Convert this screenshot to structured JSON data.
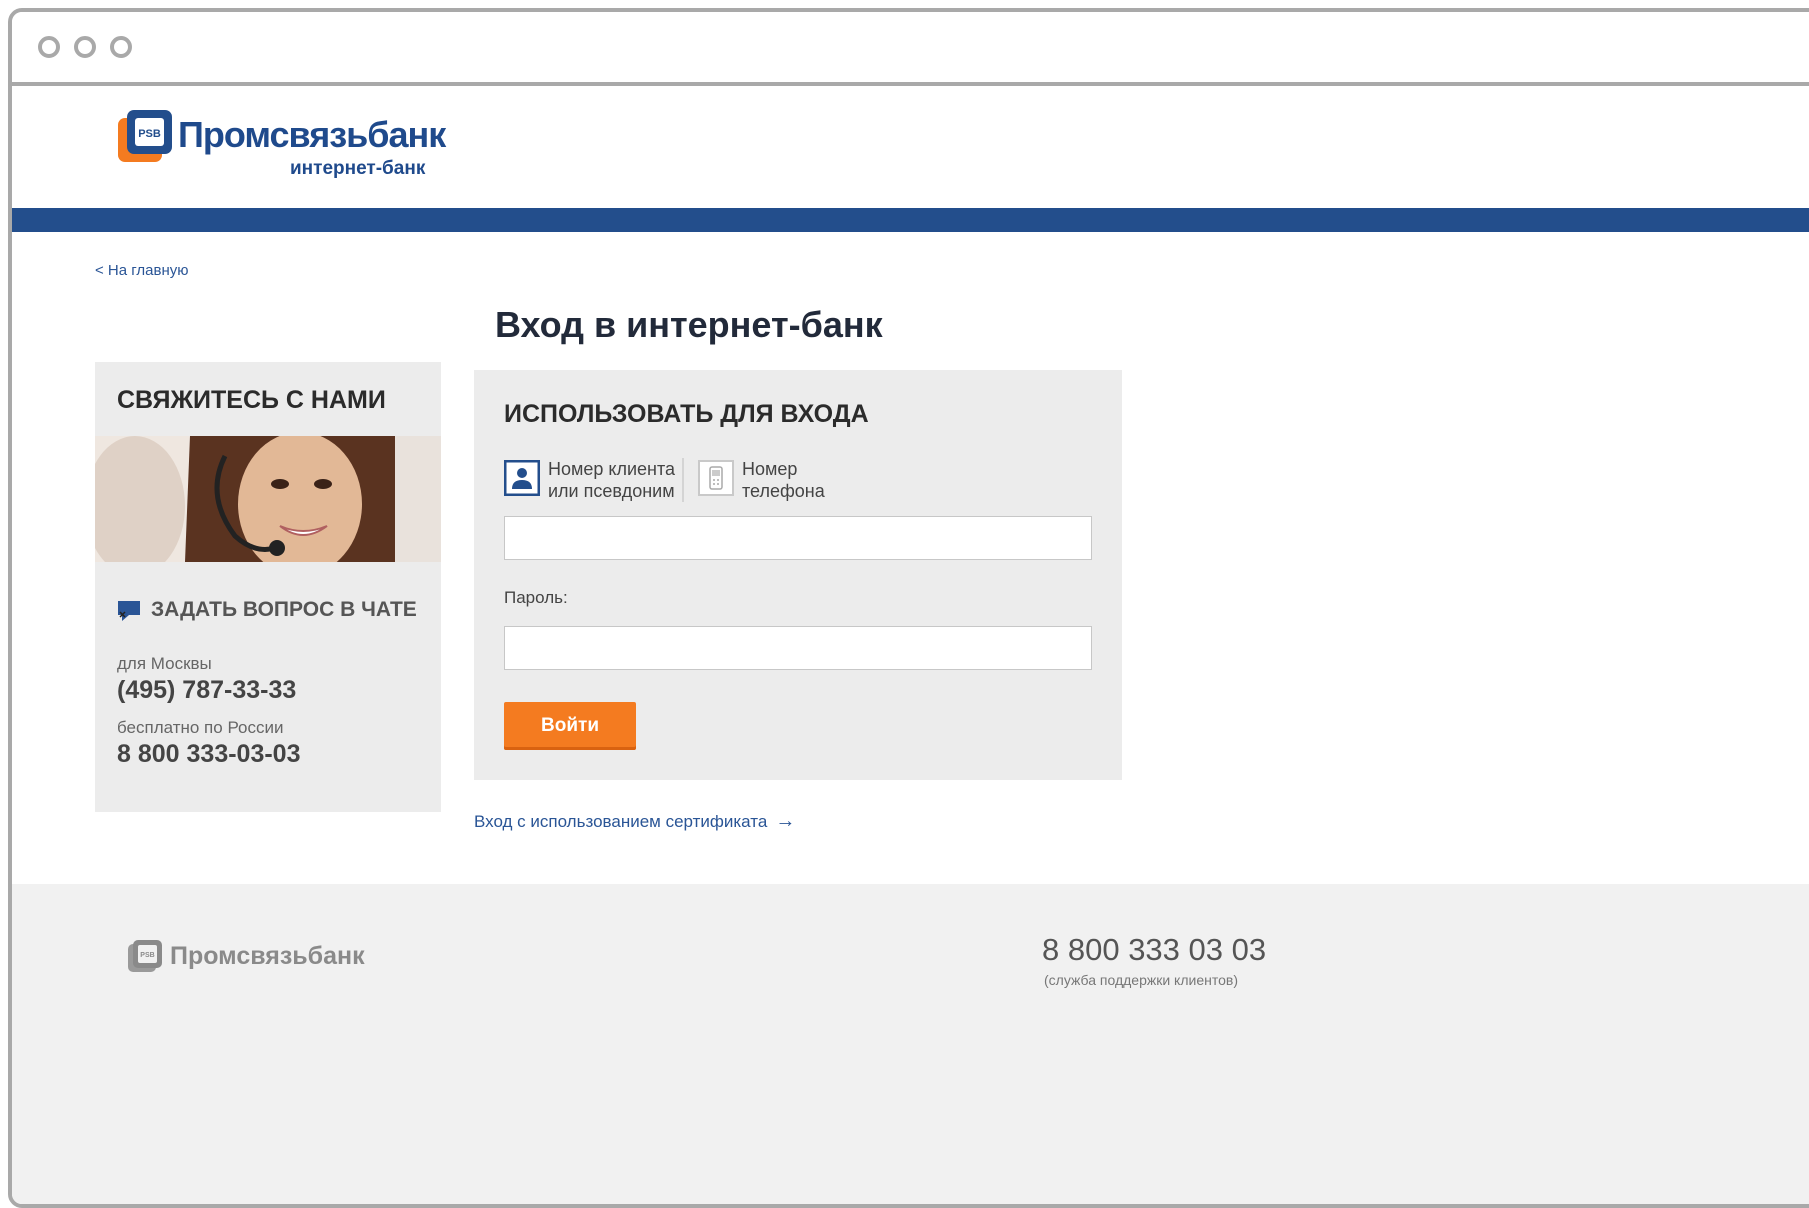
{
  "window": {
    "controls": [
      "window-dot",
      "window-dot",
      "window-dot"
    ]
  },
  "header": {
    "logo_text": "Промсвязьбанк",
    "logo_subtitle": "интернет-банк",
    "logo_mark_text": "PSB",
    "accent_color": "#234e8c",
    "logo_orange": "#f47b20"
  },
  "nav": {
    "back_link": "< На главную"
  },
  "page": {
    "title": "Вход в интернет-банк"
  },
  "contact": {
    "title": "СВЯЖИТЕСЬ С НАМИ",
    "chat_label": "ЗАДАТЬ ВОПРОС В ЧАТЕ",
    "city_label": "для Москвы",
    "city_phone": "(495) 787-33-33",
    "free_label": "бесплатно по России",
    "free_phone": "8 800 333-03-03"
  },
  "login": {
    "title": "ИСПОЛЬЗОВАТЬ ДЛЯ ВХОДА",
    "options": [
      {
        "label_line1": "Номер клиента",
        "label_line2": "или псевдоним",
        "icon": "user-icon",
        "selected": true
      },
      {
        "label_line1": "Номер",
        "label_line2": "телефона",
        "icon": "phone-icon",
        "selected": false
      }
    ],
    "login_value": "",
    "password_label": "Пароль:",
    "password_value": "",
    "submit_label": "Войти",
    "submit_color": "#f47b20"
  },
  "cert_link": "Вход с использованием сертификата",
  "footer": {
    "logo_text": "Промсвязьбанк",
    "phone": "8 800 333 03 03",
    "phone_note": "(служба поддержки клиентов)"
  }
}
